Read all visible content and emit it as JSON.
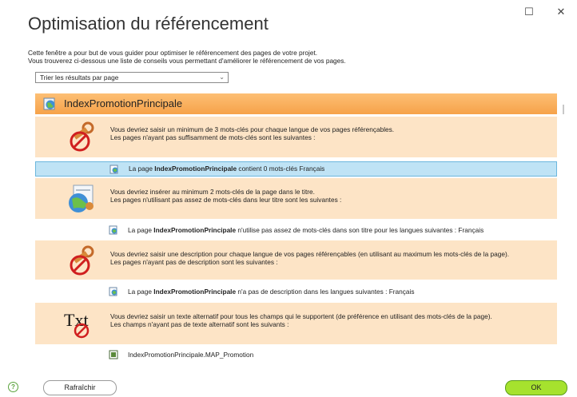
{
  "window": {
    "title": "Optimisation du référencement",
    "maximize_glyph": "☐",
    "close_glyph": "✕"
  },
  "intro": {
    "line1": "Cette fenêtre a pour but de vous guider pour optimiser le référencement des pages de votre projet.",
    "line2": "Vous trouverez ci-dessous une liste de conseils vous permettant d'améliorer le référencement de vos pages."
  },
  "sort": {
    "selected": "Trier les résultats par page",
    "chevron": "⌄"
  },
  "page": {
    "name": "IndexPromotionPrincipale",
    "icon": "globe-page-icon"
  },
  "advices": [
    {
      "icon": "keywords-forbidden-icon",
      "line1": "Vous devriez saisir un minimum de 3 mots-clés pour chaque langue de vos pages référençables.",
      "line2": "Les pages n'ayant pas suffisamment de mots-clés sont les suivantes :",
      "item": {
        "icon": "page-icon",
        "prefix": "La page ",
        "bold": "IndexPromotionPrincipale",
        "suffix": " contient 0 mots-clés Français"
      }
    },
    {
      "icon": "title-keywords-icon",
      "line1": "Vous devriez insérer au minimum 2 mots-clés de la page dans le titre.",
      "line2": "Les pages n'utilisant pas assez de mots-clés dans leur titre sont les suivantes :",
      "item": {
        "icon": "page-icon",
        "prefix": "La page ",
        "bold": "IndexPromotionPrincipale",
        "suffix": " n'utilise pas assez de mots-clés dans son titre pour les langues suivantes : Français"
      }
    },
    {
      "icon": "description-forbidden-icon",
      "line1": "Vous devriez saisir une description pour chaque langue de vos pages référençables (en utilisant au maximum les mots-clés de la page).",
      "line2": "Les pages n'ayant pas de description sont les suivantes :",
      "item": {
        "icon": "page-icon",
        "prefix": "La page ",
        "bold": "IndexPromotionPrincipale",
        "suffix": " n'a pas de description dans les langues suivantes : Français"
      }
    },
    {
      "icon": "txt-forbidden-icon",
      "icon_text": "Txt",
      "line1": "Vous devriez saisir un texte alternatif pour tous les champs qui le supportent (de préférence en utilisant des mots-clés de la page).",
      "line2": "Les champs n'ayant pas de texte alternatif sont les suivants :",
      "item": {
        "icon": "image-field-icon",
        "prefix": "IndexPromotionPrincipale.MAP_Promotion",
        "bold": "",
        "suffix": ""
      }
    }
  ],
  "footer": {
    "help_glyph": "?",
    "refresh_label": "Rafraîchir",
    "ok_label": "OK"
  },
  "colors": {
    "page_header": "#f6a24a",
    "advice_bg": "#fde4c6",
    "selected_bg": "#bfe3f5",
    "ok_bg": "#a6e22e"
  }
}
